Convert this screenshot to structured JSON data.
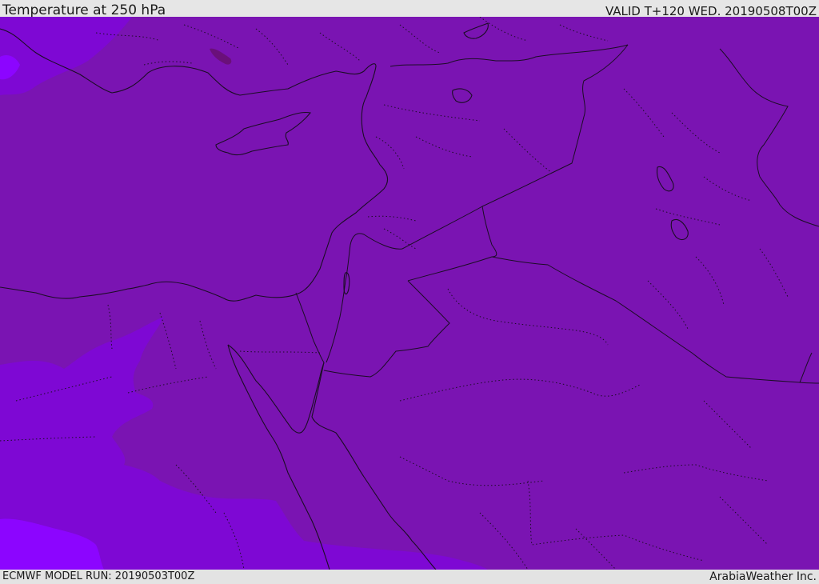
{
  "header": {
    "title": "Temperature at 250 hPa",
    "valid": "VALID T+120 WED. 20190508T00Z"
  },
  "footer": {
    "model_run": "ECMWF MODEL RUN: 20190503T00Z",
    "brand": "ArabiaWeather Inc."
  },
  "map": {
    "colors": {
      "base_field": "#7a14b2",
      "cooler_field": "#7e08d4",
      "coldest_field": "#8c05ff",
      "lines": "#1b0d24"
    },
    "icons": [
      "coastline-layer",
      "border-layer",
      "temperature-fill-layer"
    ]
  }
}
